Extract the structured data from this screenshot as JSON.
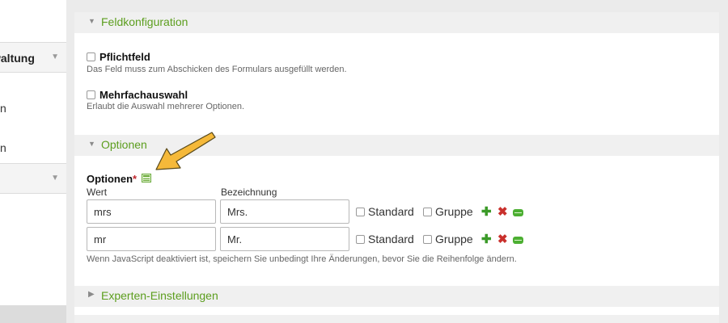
{
  "sidebar": {
    "menu1_label": "waltung",
    "fragment_1": "n",
    "fragment_2": "n"
  },
  "sections": {
    "feldkonfiguration": "Feldkonfiguration",
    "optionen": "Optionen",
    "experten": "Experten-Einstellungen"
  },
  "fields": {
    "pflichtfeld": {
      "label": "Pflichtfeld",
      "description": "Das Feld muss zum Abschicken des Formulars ausgefüllt werden."
    },
    "mehrfachauswahl": {
      "label": "Mehrfachauswahl",
      "description": "Erlaubt die Auswahl mehrerer Optionen."
    }
  },
  "options": {
    "label": "Optionen",
    "required_marker": "*",
    "columns": {
      "value": "Wert",
      "label": "Bezeichnung"
    },
    "rows": [
      {
        "value": "mrs",
        "label": "Mrs.",
        "standard": "Standard",
        "gruppe": "Gruppe"
      },
      {
        "value": "mr",
        "label": "Mr.",
        "standard": "Standard",
        "gruppe": "Gruppe"
      }
    ],
    "js_note": "Wenn JavaScript deaktiviert ist, speichern Sie unbedingt Ihre Änderungen, bevor Sie die Reihenfolge ändern."
  },
  "colors": {
    "accent_green": "#5c9e1e",
    "required_red": "#c0262d",
    "arrow_yellow": "#f5b93a"
  }
}
